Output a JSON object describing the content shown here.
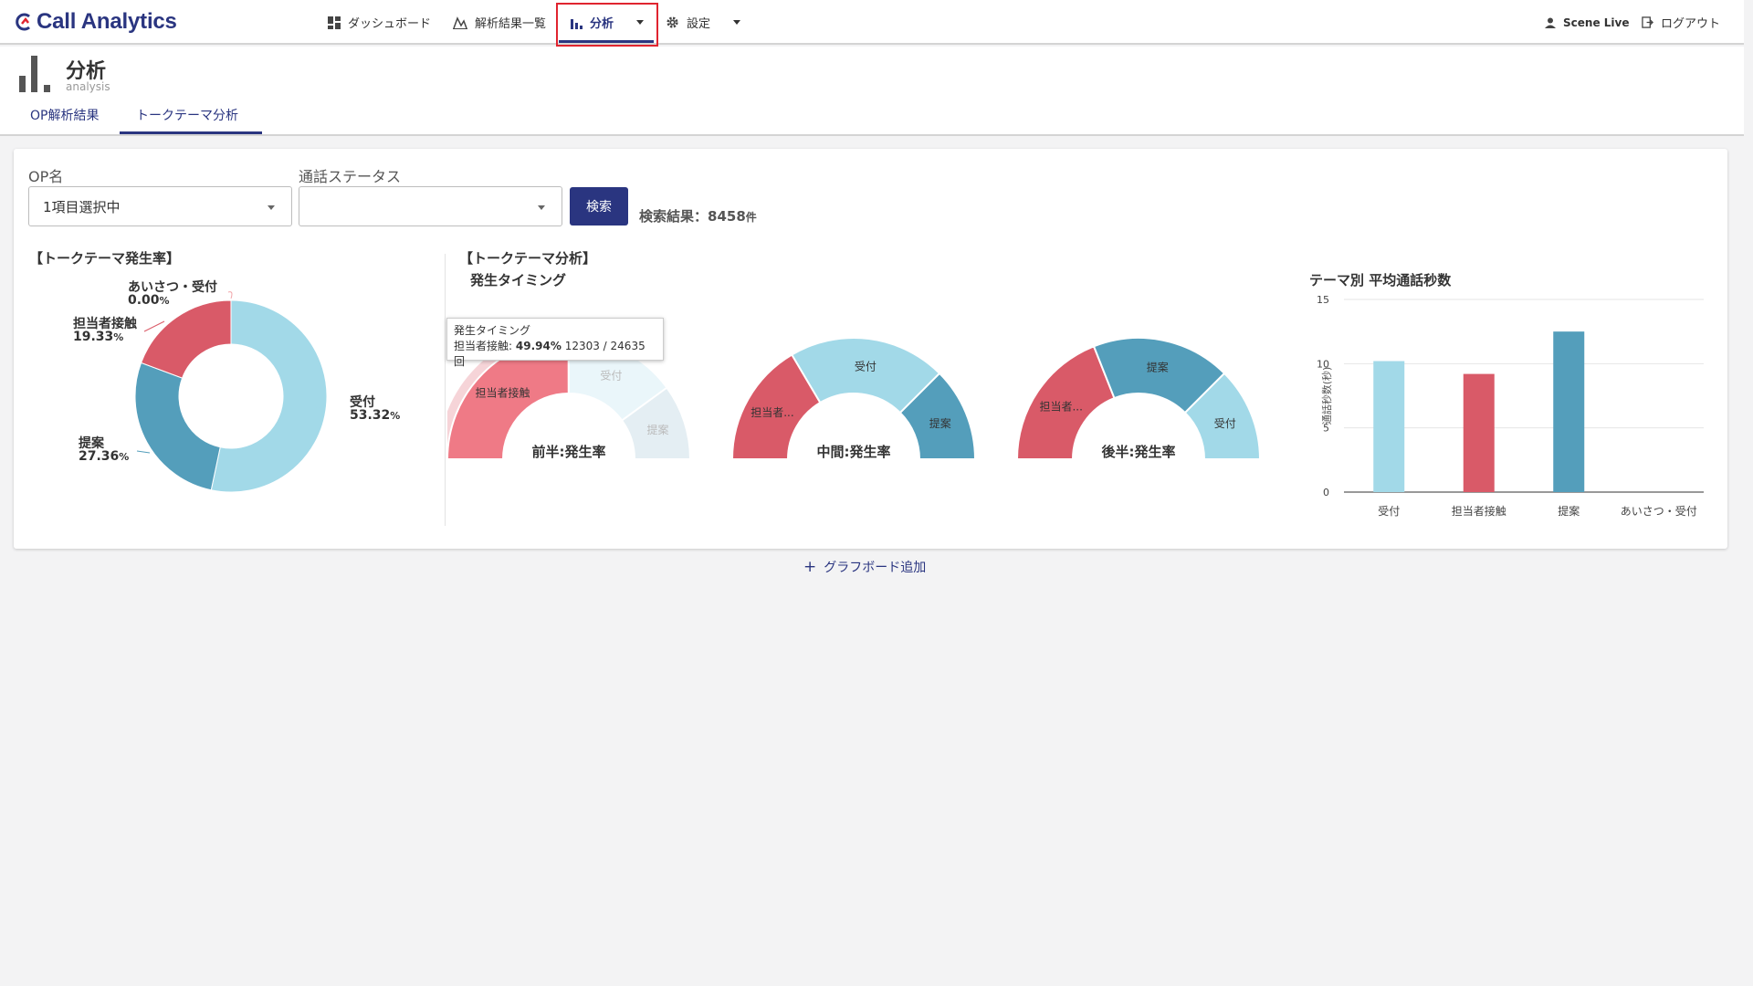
{
  "app": {
    "logo_text": "Call Analytics"
  },
  "nav": {
    "dashboard": "ダッシュボード",
    "results": "解析結果一覧",
    "analysis": "分析",
    "settings": "設定",
    "user": "Scene Live",
    "logout": "ログアウト"
  },
  "page": {
    "title": "分析",
    "subtitle": "analysis"
  },
  "tabs": [
    {
      "label": "OP解析結果",
      "active": false
    },
    {
      "label": "トークテーマ分析",
      "active": true
    }
  ],
  "filters": {
    "op_label": "OP名",
    "op_value": "1項目選択中",
    "status_label": "通話ステータス",
    "status_value": "",
    "search_button": "検索",
    "result_label": "検索結果：",
    "result_count": "8458",
    "result_unit": "件"
  },
  "colors": {
    "uketsuke": "#a2d9e8",
    "tantousha": "#d95a68",
    "teian": "#549ebb",
    "aisatsu": "#f2a5a9",
    "brand": "#2a3580",
    "highlight": "#e0242f"
  },
  "donut": {
    "title": "【トークテーマ発生率】",
    "slices": [
      {
        "name": "受付",
        "value": 53.32,
        "label": "受付",
        "pct": "53.32"
      },
      {
        "name": "提案",
        "value": 27.36,
        "label": "提案",
        "pct": "27.36"
      },
      {
        "name": "担当者接触",
        "value": 19.33,
        "label": "担当者接触",
        "pct": "19.33"
      },
      {
        "name": "あいさつ・受付",
        "value": 0.0,
        "label": "あいさつ・受付",
        "pct": "0.00"
      }
    ],
    "pct_unit": "%"
  },
  "timing": {
    "title": "【トークテーマ分析】",
    "subtitle": "発生タイミング",
    "tooltip": {
      "title": "発生タイミング",
      "series": "担当者接触",
      "pct": "49.94%",
      "detail": "12303 / 24635 回"
    },
    "gauges": [
      {
        "center": "前半:発生率",
        "segments": [
          {
            "name": "担当者接触",
            "value": 49.94,
            "label": "担当者接触"
          },
          {
            "name": "受付",
            "value": 30.0,
            "label": "受付"
          },
          {
            "name": "提案",
            "value": 20.06,
            "label": "提案"
          }
        ]
      },
      {
        "center": "中間:発生率",
        "segments": [
          {
            "name": "担当者接触",
            "value": 33,
            "label": "担当者..."
          },
          {
            "name": "受付",
            "value": 42,
            "label": "受付"
          },
          {
            "name": "提案",
            "value": 25,
            "label": "提案"
          }
        ]
      },
      {
        "center": "後半:発生率",
        "segments": [
          {
            "name": "担当者接触",
            "value": 38,
            "label": "担当者..."
          },
          {
            "name": "提案",
            "value": 37,
            "label": "提案"
          },
          {
            "name": "受付",
            "value": 25,
            "label": "受付"
          }
        ]
      }
    ]
  },
  "chart_data": {
    "type": "bar",
    "title": "テーマ別 平均通話秒数",
    "ylabel": "通話秒数(秒)",
    "xlabel": "",
    "categories": [
      "受付",
      "担当者接触",
      "提案",
      "あいさつ・受付"
    ],
    "values": [
      10.2,
      9.2,
      12.5,
      0
    ],
    "ylim": [
      0,
      15
    ],
    "yticks": [
      "15",
      "10",
      "5",
      "0"
    ],
    "grid": true
  },
  "footer": {
    "add_board": "グラフボード追加",
    "plus": "+"
  }
}
